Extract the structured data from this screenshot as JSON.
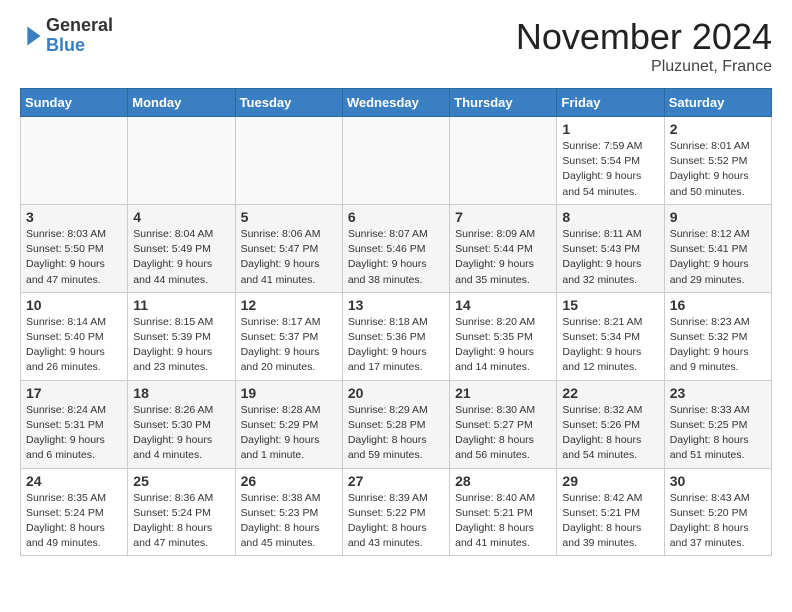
{
  "header": {
    "logo": {
      "line1": "General",
      "line2": "Blue"
    },
    "title": "November 2024",
    "location": "Pluzunet, France"
  },
  "weekdays": [
    "Sunday",
    "Monday",
    "Tuesday",
    "Wednesday",
    "Thursday",
    "Friday",
    "Saturday"
  ],
  "weeks": [
    [
      {
        "day": "",
        "info": ""
      },
      {
        "day": "",
        "info": ""
      },
      {
        "day": "",
        "info": ""
      },
      {
        "day": "",
        "info": ""
      },
      {
        "day": "",
        "info": ""
      },
      {
        "day": "1",
        "info": "Sunrise: 7:59 AM\nSunset: 5:54 PM\nDaylight: 9 hours\nand 54 minutes."
      },
      {
        "day": "2",
        "info": "Sunrise: 8:01 AM\nSunset: 5:52 PM\nDaylight: 9 hours\nand 50 minutes."
      }
    ],
    [
      {
        "day": "3",
        "info": "Sunrise: 8:03 AM\nSunset: 5:50 PM\nDaylight: 9 hours\nand 47 minutes."
      },
      {
        "day": "4",
        "info": "Sunrise: 8:04 AM\nSunset: 5:49 PM\nDaylight: 9 hours\nand 44 minutes."
      },
      {
        "day": "5",
        "info": "Sunrise: 8:06 AM\nSunset: 5:47 PM\nDaylight: 9 hours\nand 41 minutes."
      },
      {
        "day": "6",
        "info": "Sunrise: 8:07 AM\nSunset: 5:46 PM\nDaylight: 9 hours\nand 38 minutes."
      },
      {
        "day": "7",
        "info": "Sunrise: 8:09 AM\nSunset: 5:44 PM\nDaylight: 9 hours\nand 35 minutes."
      },
      {
        "day": "8",
        "info": "Sunrise: 8:11 AM\nSunset: 5:43 PM\nDaylight: 9 hours\nand 32 minutes."
      },
      {
        "day": "9",
        "info": "Sunrise: 8:12 AM\nSunset: 5:41 PM\nDaylight: 9 hours\nand 29 minutes."
      }
    ],
    [
      {
        "day": "10",
        "info": "Sunrise: 8:14 AM\nSunset: 5:40 PM\nDaylight: 9 hours\nand 26 minutes."
      },
      {
        "day": "11",
        "info": "Sunrise: 8:15 AM\nSunset: 5:39 PM\nDaylight: 9 hours\nand 23 minutes."
      },
      {
        "day": "12",
        "info": "Sunrise: 8:17 AM\nSunset: 5:37 PM\nDaylight: 9 hours\nand 20 minutes."
      },
      {
        "day": "13",
        "info": "Sunrise: 8:18 AM\nSunset: 5:36 PM\nDaylight: 9 hours\nand 17 minutes."
      },
      {
        "day": "14",
        "info": "Sunrise: 8:20 AM\nSunset: 5:35 PM\nDaylight: 9 hours\nand 14 minutes."
      },
      {
        "day": "15",
        "info": "Sunrise: 8:21 AM\nSunset: 5:34 PM\nDaylight: 9 hours\nand 12 minutes."
      },
      {
        "day": "16",
        "info": "Sunrise: 8:23 AM\nSunset: 5:32 PM\nDaylight: 9 hours\nand 9 minutes."
      }
    ],
    [
      {
        "day": "17",
        "info": "Sunrise: 8:24 AM\nSunset: 5:31 PM\nDaylight: 9 hours\nand 6 minutes."
      },
      {
        "day": "18",
        "info": "Sunrise: 8:26 AM\nSunset: 5:30 PM\nDaylight: 9 hours\nand 4 minutes."
      },
      {
        "day": "19",
        "info": "Sunrise: 8:28 AM\nSunset: 5:29 PM\nDaylight: 9 hours\nand 1 minute."
      },
      {
        "day": "20",
        "info": "Sunrise: 8:29 AM\nSunset: 5:28 PM\nDaylight: 8 hours\nand 59 minutes."
      },
      {
        "day": "21",
        "info": "Sunrise: 8:30 AM\nSunset: 5:27 PM\nDaylight: 8 hours\nand 56 minutes."
      },
      {
        "day": "22",
        "info": "Sunrise: 8:32 AM\nSunset: 5:26 PM\nDaylight: 8 hours\nand 54 minutes."
      },
      {
        "day": "23",
        "info": "Sunrise: 8:33 AM\nSunset: 5:25 PM\nDaylight: 8 hours\nand 51 minutes."
      }
    ],
    [
      {
        "day": "24",
        "info": "Sunrise: 8:35 AM\nSunset: 5:24 PM\nDaylight: 8 hours\nand 49 minutes."
      },
      {
        "day": "25",
        "info": "Sunrise: 8:36 AM\nSunset: 5:24 PM\nDaylight: 8 hours\nand 47 minutes."
      },
      {
        "day": "26",
        "info": "Sunrise: 8:38 AM\nSunset: 5:23 PM\nDaylight: 8 hours\nand 45 minutes."
      },
      {
        "day": "27",
        "info": "Sunrise: 8:39 AM\nSunset: 5:22 PM\nDaylight: 8 hours\nand 43 minutes."
      },
      {
        "day": "28",
        "info": "Sunrise: 8:40 AM\nSunset: 5:21 PM\nDaylight: 8 hours\nand 41 minutes."
      },
      {
        "day": "29",
        "info": "Sunrise: 8:42 AM\nSunset: 5:21 PM\nDaylight: 8 hours\nand 39 minutes."
      },
      {
        "day": "30",
        "info": "Sunrise: 8:43 AM\nSunset: 5:20 PM\nDaylight: 8 hours\nand 37 minutes."
      }
    ]
  ]
}
